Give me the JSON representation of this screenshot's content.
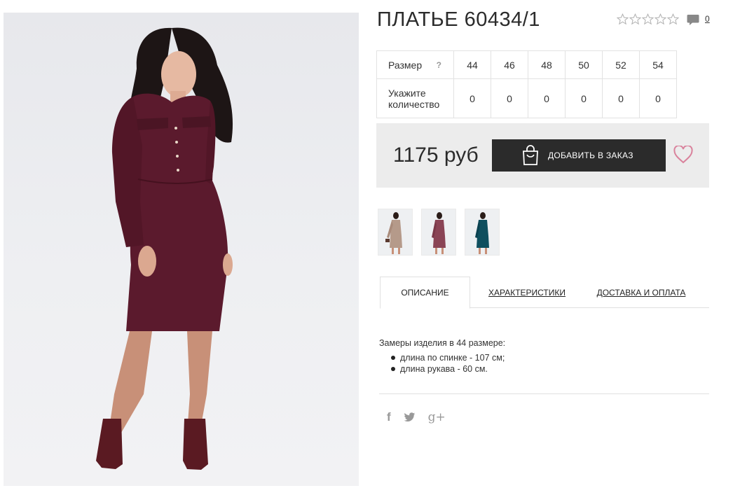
{
  "product": {
    "title": "ПЛАТЬЕ 60434/1",
    "rating_stars": 5,
    "rating_value": 0,
    "comments_count": "0"
  },
  "size_table": {
    "size_label": "Размер",
    "help_symbol": "?",
    "sizes": [
      "44",
      "46",
      "48",
      "50",
      "52",
      "54"
    ],
    "qty_label_line1": "Укажите",
    "qty_label_line2": "количество",
    "quantities": [
      "0",
      "0",
      "0",
      "0",
      "0",
      "0"
    ]
  },
  "buy": {
    "price": "1175 руб",
    "add_button_label": "ДОБАВИТЬ В ЗАКАЗ"
  },
  "thumbnails": [
    {
      "name": "thumb-beige",
      "color": "#b59a8a"
    },
    {
      "name": "thumb-burgundy",
      "color": "#7a2d3c"
    },
    {
      "name": "thumb-teal",
      "color": "#0f4f5e"
    }
  ],
  "tabs": [
    {
      "label": "ОПИСАНИЕ",
      "active": true
    },
    {
      "label": "ХАРАКТЕРИСТИКИ",
      "active": false
    },
    {
      "label": "ДОСТАВКА И ОПЛАТА",
      "active": false
    }
  ],
  "description": {
    "intro": "Замеры изделия в 44 размере:",
    "items": [
      "длина по спинке - 107 см;",
      "длина рукава - 60 см."
    ]
  },
  "social": {
    "facebook": "f",
    "twitter": "twitter-icon",
    "google": "g+"
  },
  "colors": {
    "dress": "#5b1a2d",
    "button": "#2b2b2b",
    "heart": "#d9829c",
    "buy_box_bg": "#ececec"
  }
}
